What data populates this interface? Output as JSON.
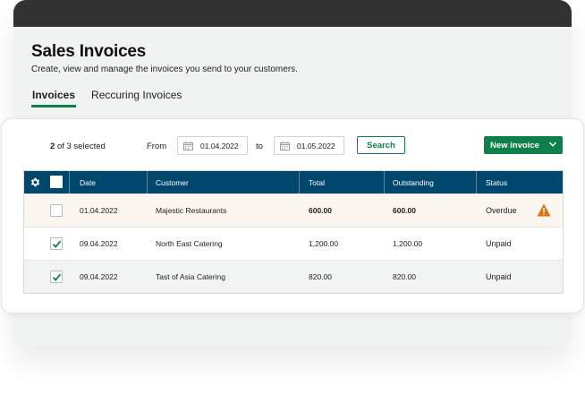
{
  "page": {
    "title": "Sales Invoices",
    "subtitle": "Create, view and manage the invoices you send to your customers."
  },
  "tabs": [
    {
      "label": "Invoices",
      "active": true
    },
    {
      "label": "Reccuring Invoices",
      "active": false
    }
  ],
  "toolbar": {
    "selected_count": "2",
    "selected_rest": "of 3 selected",
    "from_label": "From",
    "from_date": "01.04.2022",
    "to_label": "to",
    "to_date": "01.05.2022",
    "search_label": "Search",
    "new_invoice_label": "New invoice"
  },
  "table": {
    "columns": [
      "Date",
      "Customer",
      "Total",
      "Outstanding",
      "Status"
    ],
    "rows": [
      {
        "checked": false,
        "date": "01.04.2022",
        "customer": "Majestic Restaurants",
        "total": "600.00",
        "outstanding": "600.00",
        "status": "Overdue",
        "warning": true
      },
      {
        "checked": true,
        "date": "09.04.2022",
        "customer": "North East Catering",
        "total": "1,200.00",
        "outstanding": "1,200.00",
        "status": "Unpaid",
        "warning": false
      },
      {
        "checked": true,
        "date": "09.04.2022",
        "customer": "Tast of Asia Catering",
        "total": "820.00",
        "outstanding": "820.00",
        "status": "Unpaid",
        "warning": false
      }
    ]
  },
  "colors": {
    "brand_green": "#0f8049",
    "header_blue": "#00476e",
    "warning_orange": "#e0730a",
    "topbar": "#323232"
  },
  "icons": [
    "gear-icon",
    "calendar-icon",
    "chevron-down-icon",
    "checkmark-icon",
    "warning-icon"
  ]
}
